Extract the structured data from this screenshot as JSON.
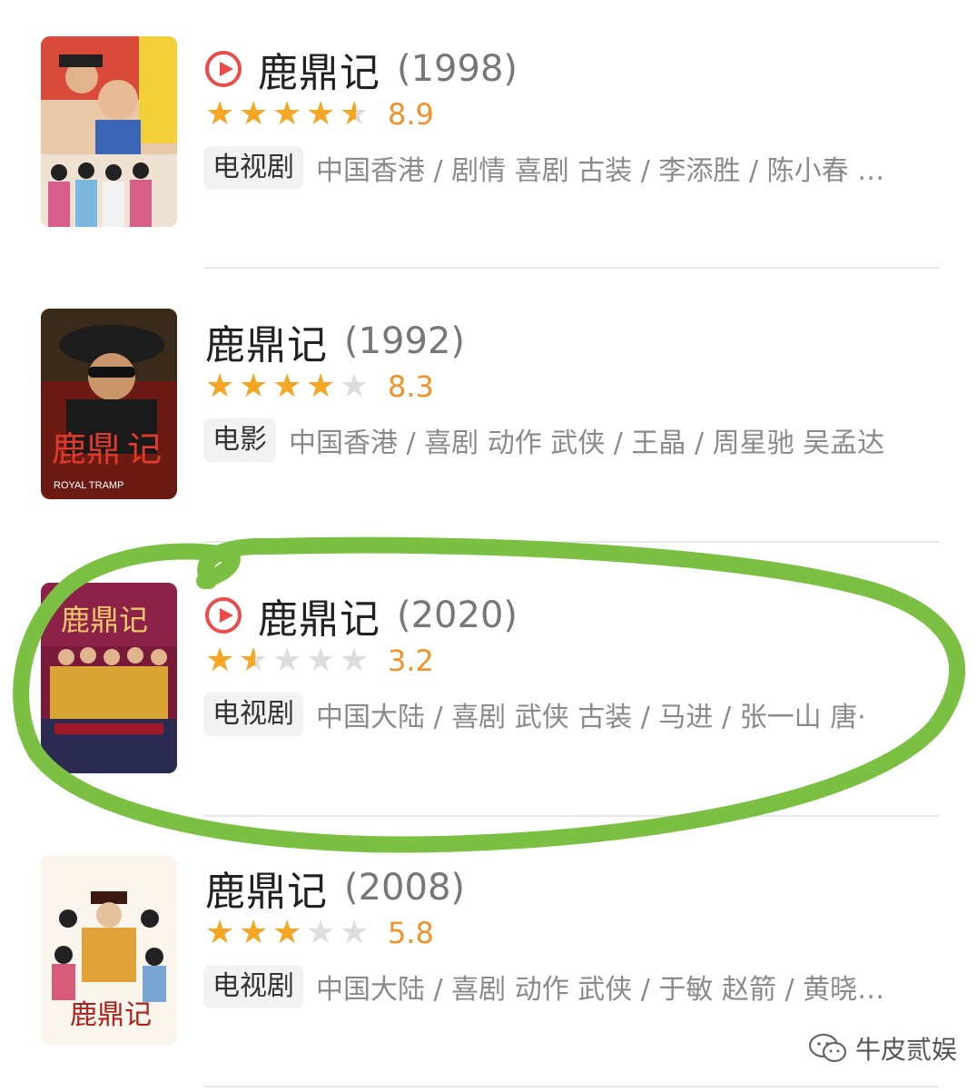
{
  "results": [
    {
      "title": "鹿鼎记",
      "year": "(1998)",
      "has_play": true,
      "rating": 8.9,
      "stars_filled": 4.5,
      "rating_text": "8.9",
      "tag": "电视剧",
      "meta": "中国香港 / 剧情 喜剧 古装 / 李添胜 / 陈小春 …"
    },
    {
      "title": "鹿鼎记",
      "year": "(1992)",
      "has_play": false,
      "rating": 8.3,
      "stars_filled": 4,
      "rating_text": "8.3",
      "tag": "电影",
      "meta": "中国香港 / 喜剧 动作 武侠 / 王晶 / 周星驰 吴孟达",
      "poster_text": "ROYAL TRAMP"
    },
    {
      "title": "鹿鼎记",
      "year": "(2020)",
      "has_play": true,
      "rating": 3.2,
      "stars_filled": 1.5,
      "rating_text": "3.2",
      "tag": "电视剧",
      "meta": "中国大陆 / 喜剧 武侠 古装 / 马进 / 张一山 唐·"
    },
    {
      "title": "鹿鼎记",
      "year": "(2008)",
      "has_play": false,
      "rating": 5.8,
      "stars_filled": 3,
      "rating_text": "5.8",
      "tag": "电视剧",
      "meta": "中国大陆 / 喜剧 动作 武侠 / 于敏 赵箭 / 黄晓…"
    }
  ],
  "annotation": {
    "color": "#7bc043",
    "circled_item_index": 2
  },
  "watermark": {
    "text": "牛皮贰娱",
    "icon": "wechat-icon"
  },
  "colors": {
    "star": "#f5a623",
    "star_empty": "#dddddd",
    "score": "#f0932b",
    "play": "#ea4b4b"
  }
}
